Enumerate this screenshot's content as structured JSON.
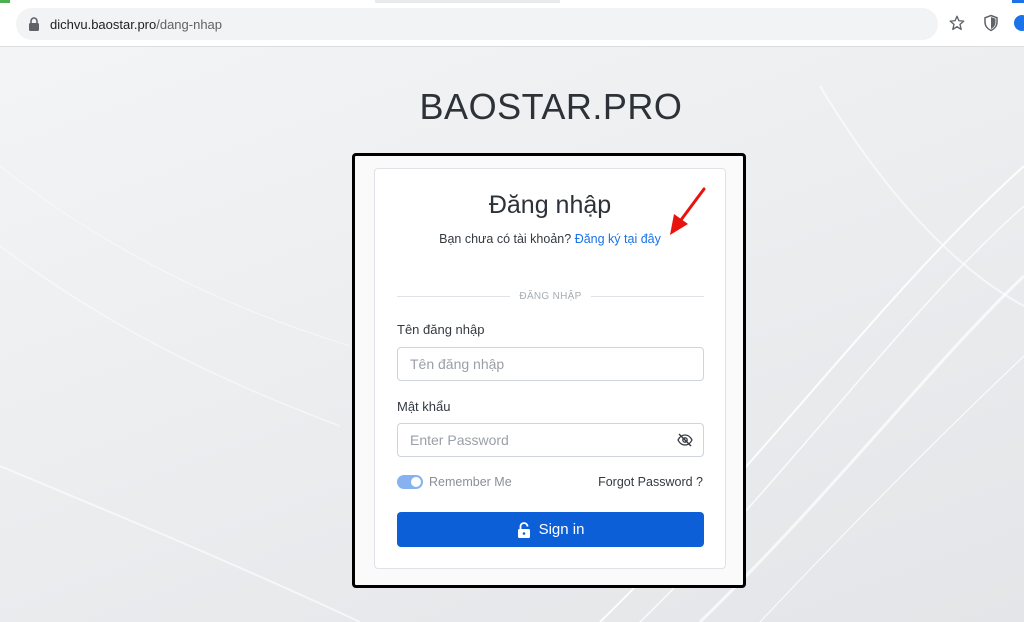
{
  "browser": {
    "url_host": "dichvu.baostar.pro",
    "url_path": "/dang-nhap"
  },
  "icons": {
    "lock": "lock-icon",
    "star": "bookmark-star-icon",
    "shield": "shield-extension-icon",
    "eye": "eye-slash-icon",
    "unlock": "unlock-icon",
    "arrow": "red-arrow-annotation"
  },
  "page": {
    "brand": "BAOSTAR.PRO"
  },
  "login": {
    "title": "Đăng nhập",
    "signup_prompt": "Bạn chưa có tài khoản?",
    "signup_link": "Đăng ký tại đây",
    "divider_text": "ĐĂNG NHẬP",
    "username_label": "Tên đăng nhập",
    "username_placeholder": "Tên đăng nhập",
    "username_value": "",
    "password_label": "Mật khẩu",
    "password_placeholder": "Enter Password",
    "password_value": "",
    "remember_label": "Remember Me",
    "remember_checked": true,
    "forgot_label": "Forgot Password ?",
    "signin_label": "Sign in"
  },
  "colors": {
    "primary": "#0d5fd8",
    "link": "#1a73e8",
    "annotation": "#e8130f",
    "toggle": "#86b3f0"
  }
}
